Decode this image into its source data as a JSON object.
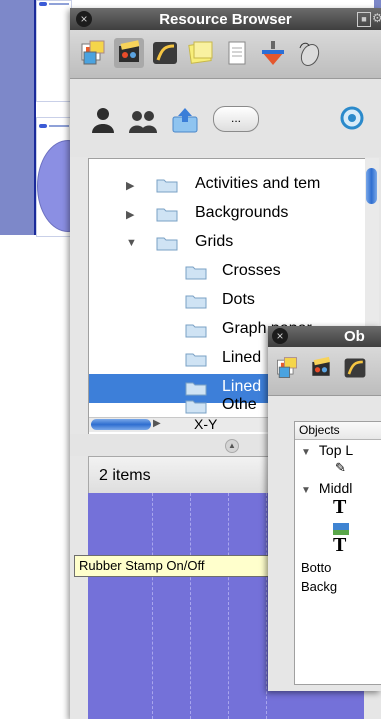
{
  "resource_browser": {
    "title": "Resource Browser",
    "close_glyph": "×",
    "toolbar_icons": [
      "gallery-icon",
      "movie-icon",
      "flash-icon",
      "notes-icon",
      "document-icon",
      "spinning-top-icon",
      "mouse-icon"
    ],
    "tree": [
      {
        "label": "Activities and tem",
        "level": 1,
        "expanded": false
      },
      {
        "label": "Backgrounds",
        "level": 1,
        "expanded": false
      },
      {
        "label": "Grids",
        "level": 1,
        "expanded": true
      },
      {
        "label": "Crosses",
        "level": 2
      },
      {
        "label": "Dots",
        "level": 2
      },
      {
        "label": "Graph paper",
        "level": 2
      },
      {
        "label": "Lined",
        "level": 2
      },
      {
        "label": "Lined",
        "level": 2,
        "selected": true
      },
      {
        "label": "Othe",
        "level": 2
      },
      {
        "label": "X-Y",
        "level": 2,
        "expanded": false
      }
    ],
    "item_count": "2 items",
    "splitter_glyph": "▲",
    "more_button": "..."
  },
  "tooltip": "Rubber Stamp On/Off",
  "objects_window": {
    "title": "Ob",
    "column_header": "Objects",
    "tree": [
      {
        "label": "Top L",
        "expanded": true
      },
      {
        "label": "Middl",
        "expanded": true
      },
      {
        "label": "Botto"
      },
      {
        "label": "Backg"
      }
    ]
  },
  "colors": {
    "selection": "#3d7fd9",
    "preview": "#7471d9",
    "slide_background": "#7d88c9"
  }
}
